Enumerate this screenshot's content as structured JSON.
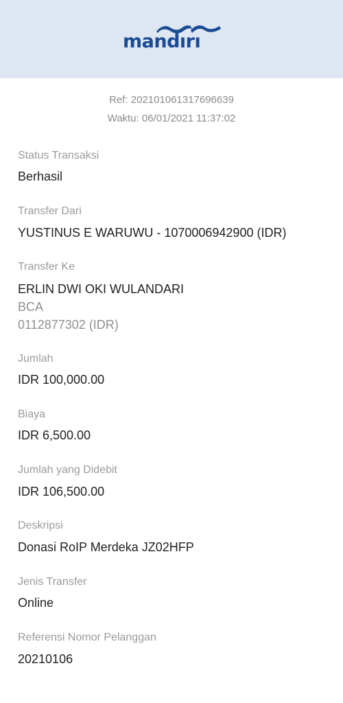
{
  "header": {
    "logo_text": "mandırı",
    "logo_icon": "mandiri-wave-icon",
    "brand_color": "#1b4b93",
    "background_color": "#dde6f1"
  },
  "receipt": {
    "ref": "Ref: 202101061317696639",
    "time": "Waktu: 06/01/2021 11:37:02"
  },
  "fields": {
    "status": {
      "label": "Status Transaksi",
      "value": "Berhasil"
    },
    "from": {
      "label": "Transfer Dari",
      "value": "YUSTINUS E WARUWU - 1070006942900 (IDR)"
    },
    "to": {
      "label": "Transfer Ke",
      "name": "ERLIN DWI OKI WULANDARI",
      "bank": "BCA",
      "account": "0112877302 (IDR)"
    },
    "amount": {
      "label": "Jumlah",
      "value": "IDR 100,000.00"
    },
    "fee": {
      "label": "Biaya",
      "value": "IDR 6,500.00"
    },
    "debited": {
      "label": "Jumlah yang Didebit",
      "value": "IDR 106,500.00"
    },
    "description": {
      "label": "Deskripsi",
      "value": "Donasi RoIP Merdeka JZ02HFP"
    },
    "transfer_type": {
      "label": "Jenis Transfer",
      "value": "Online"
    },
    "customer_ref": {
      "label": "Referensi Nomor Pelanggan",
      "value": "20210106"
    }
  }
}
